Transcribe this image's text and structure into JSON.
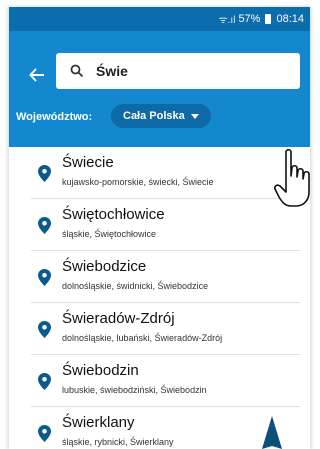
{
  "statusbar": {
    "battery": "57%",
    "time": "08:14"
  },
  "search": {
    "value": "Świe"
  },
  "filter": {
    "label": "Województwo:",
    "value": "Cała Polska"
  },
  "results": [
    {
      "name": "Świecie",
      "details": "kujawsko-pomorskie, świecki, Świecie"
    },
    {
      "name": "Świętochłowice",
      "details": "śląskie, Świętochłowice"
    },
    {
      "name": "Świebodzice",
      "details": "dolnośląskie, świdnicki, Świebodzice"
    },
    {
      "name": "Świeradów-Zdrój",
      "details": "dolnośląskie, lubański, Świeradów-Zdrój"
    },
    {
      "name": "Świebodzin",
      "details": "lubuskie, świebodziński, Świebodzin"
    },
    {
      "name": "Świerklany",
      "details": "śląskie, rybnicki, Świerklany"
    }
  ],
  "colors": {
    "appbar": "#1488cf",
    "statusbar": "#0c6dad",
    "pin": "#0b5a8c"
  },
  "icons": {
    "back": "arrow-left-icon",
    "search": "search-icon",
    "pin": "location-pin-icon",
    "pointer": "hand-pointer-icon"
  }
}
